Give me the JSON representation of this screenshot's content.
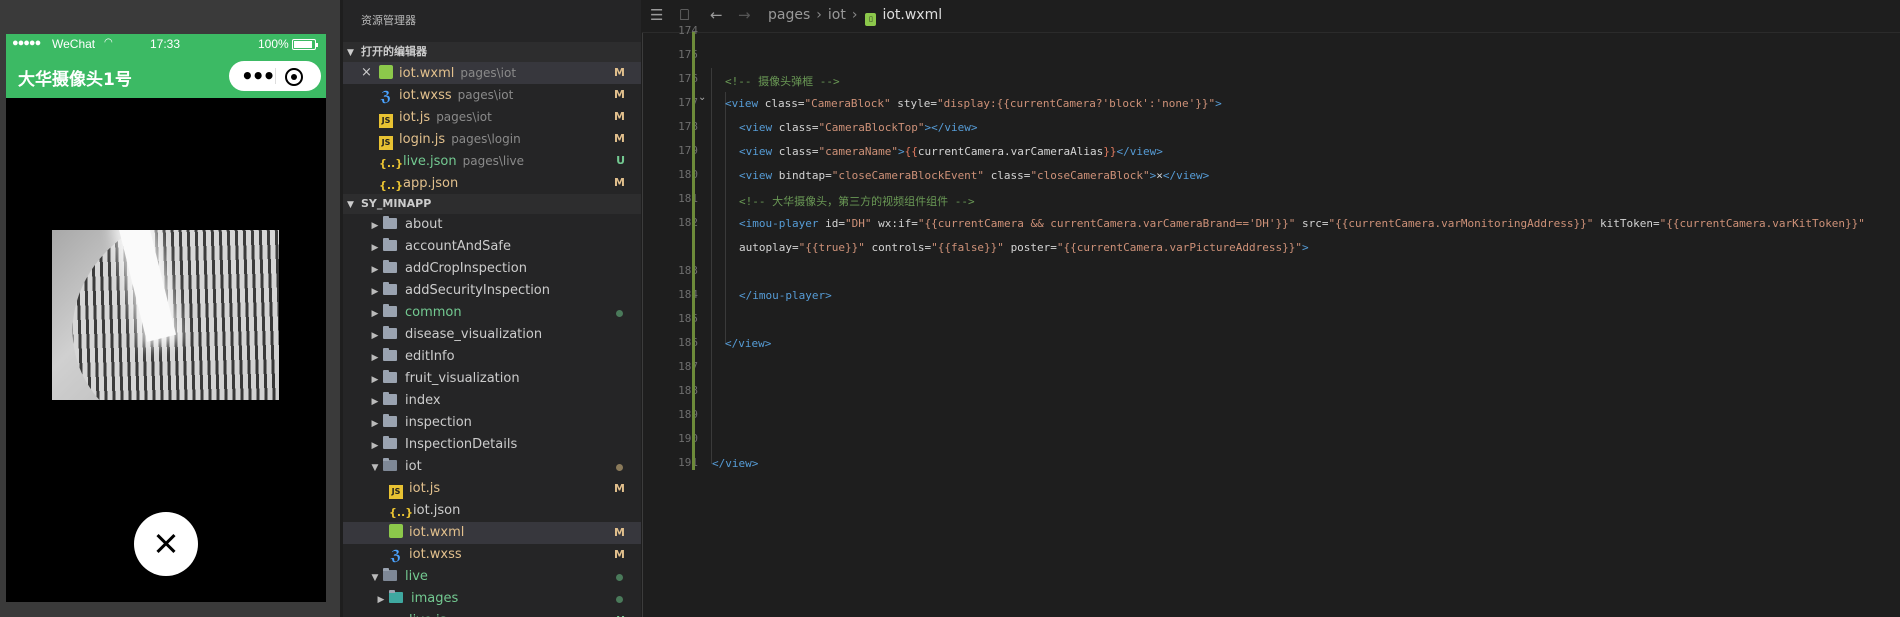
{
  "simulator": {
    "status": {
      "signal_dots": "●●●●●",
      "carrier": "WeChat",
      "wifi_icon": "wifi-icon",
      "time": "17:33",
      "battery_pct": "100%"
    },
    "nav_title": "大华摄像头1号",
    "capsule": {
      "more_icon": "•••",
      "target_icon": "target-icon"
    },
    "close_icon": "close-icon"
  },
  "explorer": {
    "title": "资源管理器",
    "open_editors_label": "打开的编辑器",
    "open_editors": [
      {
        "name": "iot.wxml",
        "path": "pages\\iot",
        "badge": "M",
        "type": "wxml",
        "active": true,
        "close": "×"
      },
      {
        "name": "iot.wxss",
        "path": "pages\\iot",
        "badge": "M",
        "type": "wxss"
      },
      {
        "name": "iot.js",
        "path": "pages\\iot",
        "badge": "M",
        "type": "js"
      },
      {
        "name": "login.js",
        "path": "pages\\login",
        "badge": "M",
        "type": "js"
      },
      {
        "name": "live.json",
        "path": "pages\\live",
        "badge": "U",
        "type": "json"
      },
      {
        "name": "app.json",
        "path": "",
        "badge": "M",
        "type": "json"
      }
    ],
    "project_label": "SY_MINAPP",
    "tree": [
      {
        "name": "about",
        "kind": "folder"
      },
      {
        "name": "accountAndSafe",
        "kind": "folder"
      },
      {
        "name": "addCropInspection",
        "kind": "folder"
      },
      {
        "name": "addSecurityInspection",
        "kind": "folder"
      },
      {
        "name": "common",
        "kind": "folder",
        "dot": "#4a7a5a"
      },
      {
        "name": "disease_visualization",
        "kind": "folder"
      },
      {
        "name": "editInfo",
        "kind": "folder"
      },
      {
        "name": "fruit_visualization",
        "kind": "folder"
      },
      {
        "name": "index",
        "kind": "folder"
      },
      {
        "name": "inspection",
        "kind": "folder"
      },
      {
        "name": "InspectionDetails",
        "kind": "folder"
      },
      {
        "name": "iot",
        "kind": "folder-open",
        "dot": "#8a7a5a"
      },
      {
        "name": "iot.js",
        "kind": "js",
        "badge": "M"
      },
      {
        "name": "iot.json",
        "kind": "json"
      },
      {
        "name": "iot.wxml",
        "kind": "wxml",
        "badge": "M",
        "active": true
      },
      {
        "name": "iot.wxss",
        "kind": "wxss",
        "badge": "M"
      },
      {
        "name": "live",
        "kind": "folder-open",
        "dot": "#4a7a5a"
      },
      {
        "name": "images",
        "kind": "folder-img",
        "dot": "#4a7a5a"
      },
      {
        "name": "live.js",
        "kind": "js",
        "badge": "U"
      }
    ]
  },
  "editor": {
    "breadcrumb": [
      "pages",
      "iot",
      "iot.wxml"
    ],
    "line_numbers": [
      "174",
      "175",
      "176",
      "177",
      "178",
      "179",
      "180",
      "181",
      "182",
      "",
      "183",
      "184",
      "185",
      "186",
      "187",
      "188",
      "189",
      "190",
      "191"
    ]
  }
}
